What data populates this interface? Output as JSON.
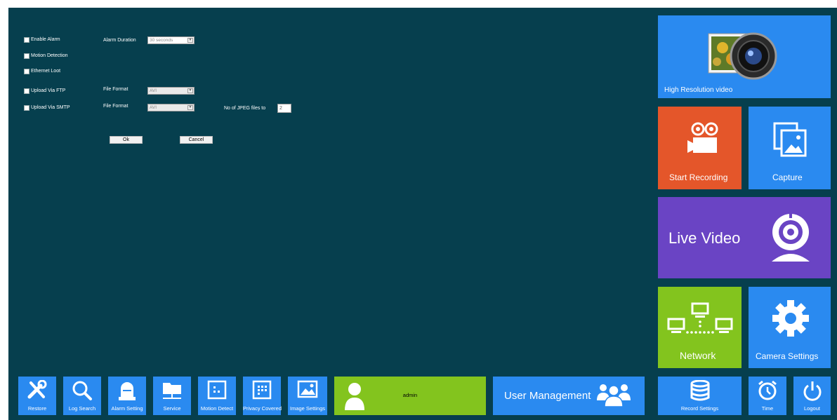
{
  "settings": {
    "enable_alarm": "Enable Alarm",
    "motion_detection": "Motion Detection",
    "ethernet_lost": "Ethernet Loot",
    "upload_ftp": "Upload Via FTP",
    "upload_smtp": "Upload Via SMTP",
    "alarm_duration_label": "Alarm Duration",
    "alarm_duration_value": "30 seconds",
    "file_format_label": "File Format",
    "ftp_file_format_value": "AVI",
    "smtp_file_format_value": "AVI",
    "jpeg_files_label": "No of JPEG files to",
    "jpeg_files_value": "2",
    "ok_label": "Ok",
    "cancel_label": "Cancel"
  },
  "tiles": {
    "high_res": "High Resolution video",
    "start_recording": "Start Recording",
    "capture": "Capture",
    "live_video": "Live Video",
    "network": "Network",
    "camera_settings": "Camera Settings"
  },
  "bottom_bar": {
    "restore": "Restore",
    "log_search": "Log Search",
    "alarm_setting": "Alarm Setting",
    "service": "Service",
    "motion_detect": "Motion Detect",
    "privacy_covered": "Privacy Covered",
    "image_settings": "Image Settings",
    "user_name": "admin",
    "user_management": "User Management",
    "record_settings": "Record Settings",
    "time": "Time",
    "logout": "Logout"
  },
  "colors": {
    "background": "#063f4e",
    "tile_blue": "#2a8af0",
    "tile_orange": "#e4562a",
    "tile_purple": "#6a44c4",
    "tile_green": "#83c41e"
  }
}
